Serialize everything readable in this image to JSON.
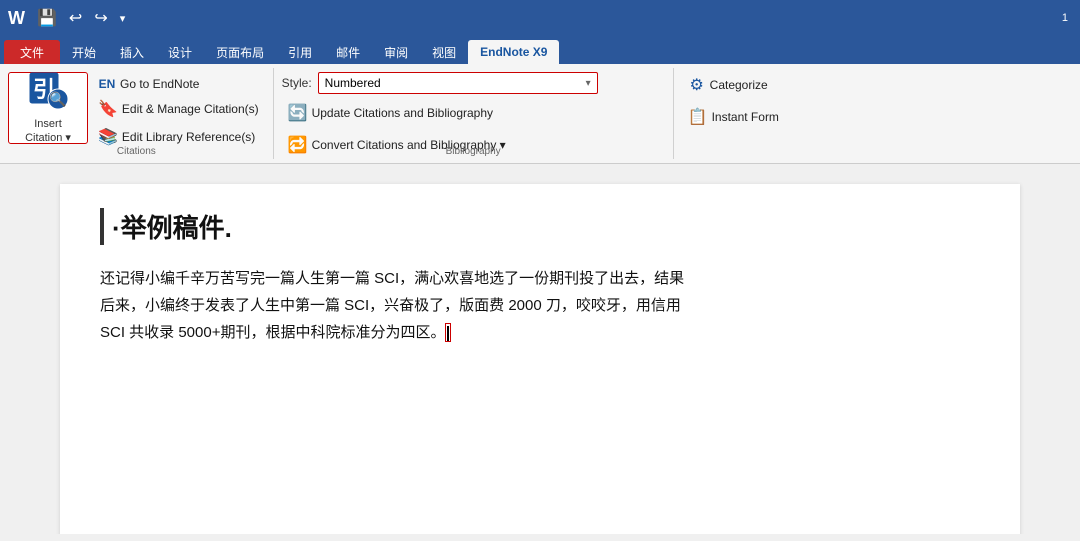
{
  "quickToolbar": {
    "buttons": [
      "W",
      "💾",
      "↩",
      "↪",
      "▾"
    ]
  },
  "ribbonTabs": [
    {
      "label": "文件",
      "type": "file"
    },
    {
      "label": "开始",
      "type": "normal"
    },
    {
      "label": "插入",
      "type": "normal"
    },
    {
      "label": "设计",
      "type": "normal"
    },
    {
      "label": "页面布局",
      "type": "normal"
    },
    {
      "label": "引用",
      "type": "normal"
    },
    {
      "label": "邮件",
      "type": "normal"
    },
    {
      "label": "审阅",
      "type": "normal"
    },
    {
      "label": "视图",
      "type": "normal"
    },
    {
      "label": "EndNote X9",
      "type": "endnote",
      "active": true
    }
  ],
  "ribbon": {
    "groups": [
      {
        "name": "citations",
        "label": "Citations",
        "insertCitation": {
          "label1": "Insert",
          "label2": "Citation ▾"
        },
        "buttons": [
          {
            "icon": "EN",
            "label": "Go to EndNote"
          },
          {
            "icon": "🔖",
            "label": "Edit & Manage Citation(s)"
          },
          {
            "icon": "📚",
            "label": "Edit Library Reference(s)"
          }
        ]
      },
      {
        "name": "bibliography",
        "label": "Bibliography",
        "styleLabel": "Style:",
        "styleValue": "Numbered",
        "buttons": [
          {
            "icon": "🔄",
            "label": "Update Citations and Bibliography"
          },
          {
            "icon": "🔁",
            "label": "Convert Citations and Bibliography ▾"
          }
        ]
      },
      {
        "name": "right",
        "label": "",
        "buttons": [
          {
            "icon": "⚙",
            "label": "Categorize"
          },
          {
            "icon": "📋",
            "label": "Instant Form"
          }
        ]
      }
    ]
  },
  "document": {
    "title": "·举例稿件.",
    "paragraphs": [
      "还记得小编千辛万苦写完一篇人生第一篇 SCI，满心欢喜地选了一份期刊投了出去，结果",
      "后来，小编终于发表了人生中第一篇 SCI，兴奋极了，版面费 2000 刀，咬咬牙，用信用",
      "SCI 共收录 5000+期刊，根据中科院标准分为四区。"
    ]
  }
}
